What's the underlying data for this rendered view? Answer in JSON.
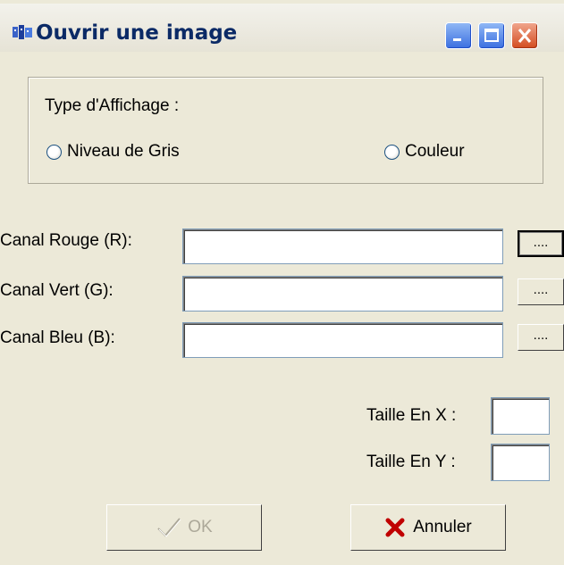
{
  "window": {
    "title": "Ouvrir une image"
  },
  "display_type": {
    "label": "Type d'Affichage :",
    "options": [
      {
        "label": "Niveau de Gris",
        "selected": false
      },
      {
        "label": "Couleur",
        "selected": false
      }
    ]
  },
  "channels": [
    {
      "label": "Canal Rouge (R):",
      "value": "",
      "browse_label": "...."
    },
    {
      "label": "Canal Vert    (G):",
      "value": "",
      "browse_label": "...."
    },
    {
      "label": "Canal Bleu    (B):",
      "value": "",
      "browse_label": "...."
    }
  ],
  "size": {
    "x_label": "Taille En  X :",
    "y_label": "Taille En  Y :",
    "x_value": "",
    "y_value": ""
  },
  "buttons": {
    "ok_label": "OK",
    "cancel_label": "Annuler"
  },
  "colors": {
    "title_text": "#0b2a66",
    "close_button": "#d34b1f",
    "cancel_icon": "#c00000"
  }
}
